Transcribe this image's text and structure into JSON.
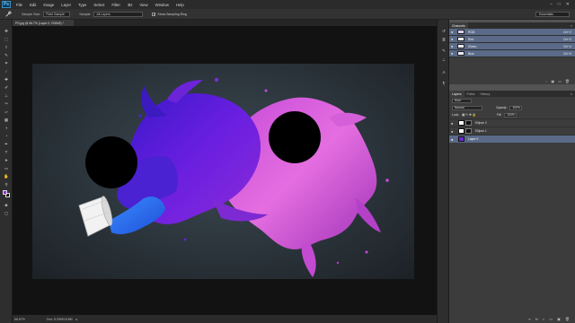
{
  "app": {
    "logo": "Ps",
    "menu": [
      "File",
      "Edit",
      "Image",
      "Layer",
      "Type",
      "Select",
      "Filter",
      "3D",
      "View",
      "Window",
      "Help"
    ],
    "window_controls": [
      "–",
      "□",
      "✕"
    ]
  },
  "options_bar": {
    "tool_icon": "eyedropper-icon",
    "sample_size_label": "Sample Size:",
    "sample_size_value": "Point Sample",
    "sample_label": "Sample:",
    "sample_value": "All Layers",
    "show_ring_label": "Show Sampling Ring",
    "show_ring_checked": "✓",
    "workspace": "Essentials"
  },
  "document": {
    "tab_title": "PS.jpg @ 66.7% (Layer 0, RGB/8) *"
  },
  "status_bar": {
    "zoom": "66.67%",
    "doc_info": "Doc: 5.93M/15.8M",
    "arrow": "▸"
  },
  "channels_panel": {
    "tab": "Channels",
    "menu_icon": "≡",
    "rows": [
      {
        "name": "RGB",
        "shortcut": "Ctrl+2"
      },
      {
        "name": "Red",
        "shortcut": "Ctrl+3"
      },
      {
        "name": "Green",
        "shortcut": "Ctrl+4"
      },
      {
        "name": "Blue",
        "shortcut": "Ctrl+5"
      }
    ],
    "footer_icons": [
      "◌",
      "▣",
      "▭",
      "🗑"
    ]
  },
  "layers_panel": {
    "tabs": [
      "Layers",
      "Paths",
      "History"
    ],
    "menu_icon": "≡",
    "kind_label": "Kind",
    "blend_mode": "Normal",
    "opacity_label": "Opacity:",
    "opacity_value": "100%",
    "lock_label": "Lock:",
    "fill_label": "Fill:",
    "fill_value": "100%",
    "layers": [
      {
        "name": "Ellipse 2",
        "selected": false
      },
      {
        "name": "Ellipse 1",
        "selected": false
      },
      {
        "name": "Layer 0",
        "selected": true
      }
    ],
    "footer_icons": [
      "∞",
      "fx",
      "◐",
      "▭",
      "▣",
      "🗑"
    ]
  },
  "colors": {
    "foreground": "#8d2cd6",
    "background": "#000000",
    "selection": "#5a6a88",
    "canvas_bg": "#2b343b"
  }
}
